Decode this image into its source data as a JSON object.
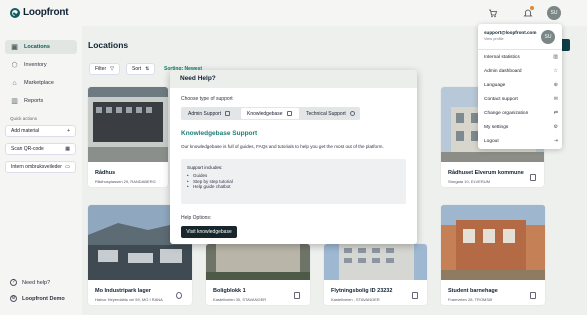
{
  "app": {
    "name": "Loopfront",
    "user_initials": "SU"
  },
  "sidebar": {
    "items": [
      {
        "label": "Locations",
        "icon": "locations-icon",
        "glyph": "▣"
      },
      {
        "label": "Inventory",
        "icon": "inventory-icon",
        "glyph": "⬡"
      },
      {
        "label": "Marketplace",
        "icon": "marketplace-icon",
        "glyph": "⌂"
      },
      {
        "label": "Reports",
        "icon": "reports-icon",
        "glyph": "▥"
      }
    ],
    "quick_actions_title": "Quick actions",
    "quick_actions": [
      {
        "label": "Add material",
        "glyph": "+"
      },
      {
        "label": "Scan QR-code",
        "glyph": "▦"
      },
      {
        "label": "Intern ombruksveileder",
        "glyph": "▭"
      }
    ],
    "need_help": "Need help?",
    "org": "Loopfront Demo"
  },
  "main": {
    "title": "Locations",
    "filter_label": "Filter",
    "sort_label": "Sort",
    "sorting_text": "Sorting: Newest",
    "cards": [
      {
        "title": "Rådhus",
        "sub": "Rådhusplassen 29, RANDABERG"
      },
      {
        "title": "Rådhuset Elverum kommune",
        "sub": "Storgata 10, ELVERUM"
      },
      {
        "title": "Mo Industripark lager",
        "sub": "Halvor Heyerdahls vei 59, MO I RANA"
      },
      {
        "title": "Boligblokk 1",
        "sub": "Kastellveien 30, STAVANGER"
      },
      {
        "title": "Flytningsbolig ID 23232",
        "sub": "Kastellveien , STAVANGER"
      },
      {
        "title": "Student barnehage",
        "sub": "Framveien 28, TROMSØ"
      }
    ]
  },
  "modal": {
    "title": "Need Help?",
    "choose_type": "Choose type of support",
    "tabs": [
      {
        "label": "Admin Support"
      },
      {
        "label": "Knowledgebase"
      },
      {
        "label": "Technical Support"
      }
    ],
    "section_title": "Knowledgebase Support",
    "section_desc": "Our knowledgebase is full of guides, FAQs and tutorials to help you get the most out of the platform.",
    "support_includes": "Support includes:",
    "includes": [
      "Guides",
      "Step by step tutorial",
      "Help guide chatbot"
    ],
    "help_options": "Help Options:",
    "visit_button": "Visit knowledgebase"
  },
  "dropdown": {
    "email": "support@loopfront.com",
    "view_profile": "View profile",
    "items": [
      {
        "label": "Internal statistics",
        "glyph": "▥"
      },
      {
        "label": "Admin dashboard",
        "glyph": "☆"
      },
      {
        "label": "Language",
        "glyph": "⊕"
      },
      {
        "label": "Contact support",
        "glyph": "✉"
      },
      {
        "label": "Change organization",
        "glyph": "⇄"
      },
      {
        "label": "My settings",
        "glyph": "⚙"
      },
      {
        "label": "Logout",
        "glyph": "⇥"
      }
    ]
  },
  "colors": {
    "accent": "#0f5d5f",
    "link": "#1b7f73",
    "dark_button": "#16262c"
  }
}
